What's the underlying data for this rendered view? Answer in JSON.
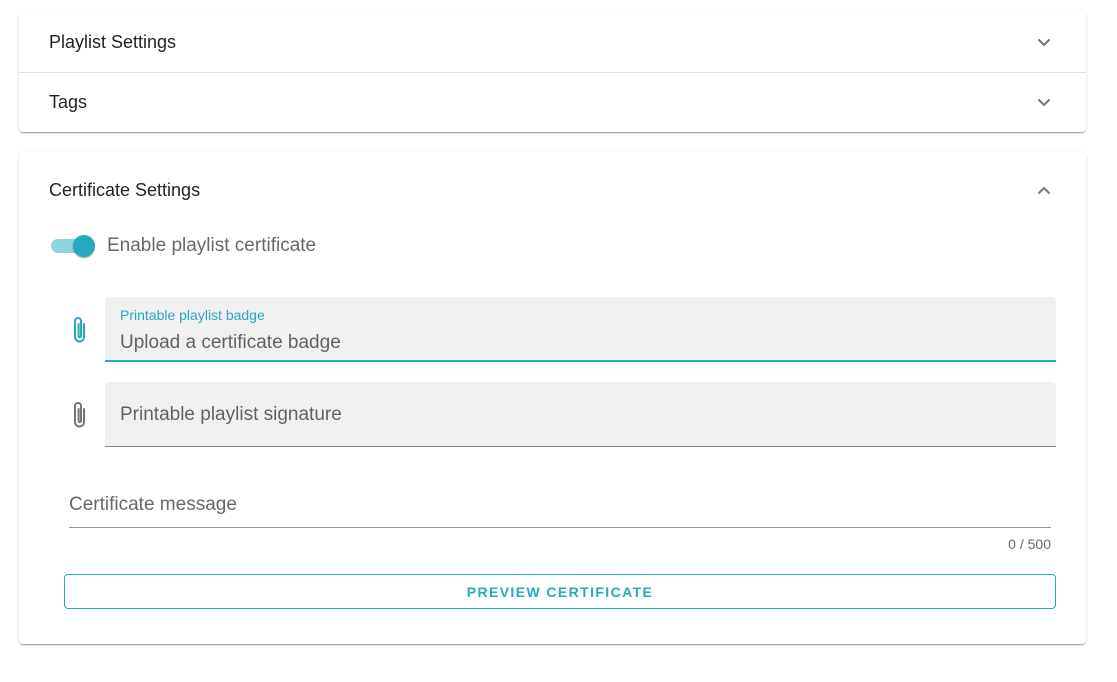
{
  "panels": {
    "playlist_settings": {
      "title": "Playlist Settings",
      "icon": "chevron-down-icon"
    },
    "tags": {
      "title": "Tags",
      "icon": "chevron-down-icon"
    }
  },
  "certificate": {
    "title": "Certificate Settings",
    "icon": "chevron-up-icon",
    "enable_switch": {
      "label": "Enable playlist certificate",
      "checked": true
    },
    "badge_field": {
      "label": "Printable playlist badge",
      "value": "Upload a certificate badge",
      "icon": "paperclip-icon"
    },
    "signature_field": {
      "label": "Printable playlist signature",
      "icon": "paperclip-icon"
    },
    "message_field": {
      "placeholder": "Certificate message",
      "counter": "0 / 500"
    },
    "preview_button": "PREVIEW CERTIFICATE"
  },
  "colors": {
    "accent": "#26a9be",
    "accent_light": "#8fd4de",
    "field_bg": "#f0f0f0"
  }
}
